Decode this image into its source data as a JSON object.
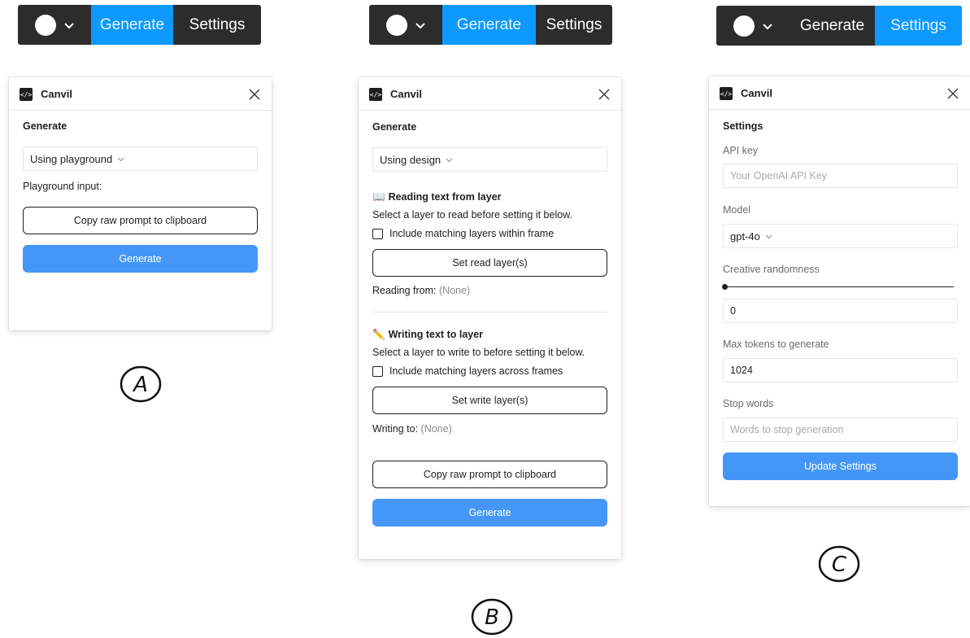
{
  "toolbar": {
    "generate_label": "Generate",
    "settings_label": "Settings",
    "accent_color": "#0d99ff",
    "bg_color": "#2c2c2c"
  },
  "plugin": {
    "name": "Canvil",
    "logo_glyph": "</>"
  },
  "panel_a": {
    "section_title": "Generate",
    "source_select": "Using playground",
    "playground_label": "Playground input:",
    "copy_button": "Copy raw prompt to clipboard",
    "generate_button": "Generate"
  },
  "panel_b": {
    "section_title": "Generate",
    "source_select": "Using design",
    "read_section": {
      "emoji": "📖",
      "title": "Reading text from layer",
      "instruction": "Select a layer to read before setting it below.",
      "checkbox_label": "Include matching layers within frame",
      "button": "Set read layer(s)",
      "status_label": "Reading from:",
      "status_value": "(None)"
    },
    "write_section": {
      "emoji": "✏️",
      "title": "Writing text to layer",
      "instruction": "Select a layer to write to before setting it below.",
      "checkbox_label": "Include matching layers across frames",
      "button": "Set write layer(s)",
      "status_label": "Writing to:",
      "status_value": "(None)"
    },
    "copy_button": "Copy raw prompt to clipboard",
    "generate_button": "Generate"
  },
  "panel_c": {
    "section_title": "Settings",
    "api_key_label": "API key",
    "api_key_placeholder": "Your OpenAI API Key",
    "model_label": "Model",
    "model_value": "gpt-4o",
    "randomness_label": "Creative randomness",
    "randomness_value": "0",
    "max_tokens_label": "Max tokens to generate",
    "max_tokens_value": "1024",
    "stop_words_label": "Stop words",
    "stop_words_placeholder": "Words to stop generation",
    "update_button": "Update Settings"
  },
  "markers": {
    "a": "A",
    "b": "B",
    "c": "C"
  }
}
